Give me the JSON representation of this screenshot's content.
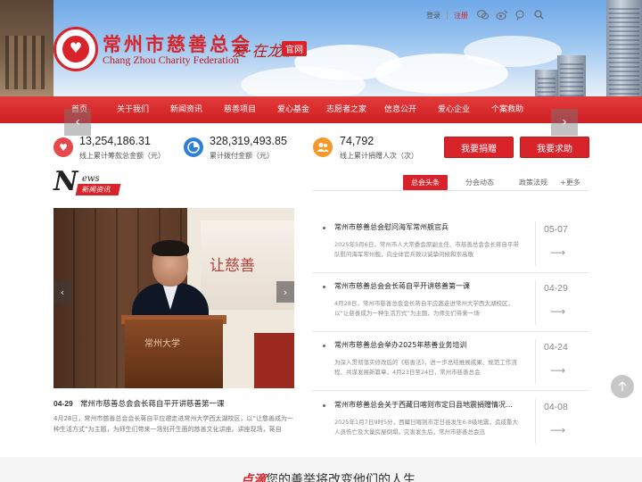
{
  "header": {
    "logo_title": "常州市慈善总会",
    "logo_subtitle": "Chang Zhou Charity Federation",
    "slogan": "爱·在龙",
    "slogan_mini": "城",
    "official_badge": "官网",
    "login": "登录",
    "register": "注册"
  },
  "nav": {
    "items": [
      "首页",
      "关于我们",
      "新闻资讯",
      "慈善项目",
      "爱心基金",
      "志愿者之家",
      "信息公开",
      "爱心企业",
      "个案救助"
    ]
  },
  "stats": [
    {
      "value": "13,254,186.31",
      "label": "线上累计筹款总金额（元）",
      "icon": "heart-icon",
      "color": "#e8474c"
    },
    {
      "value": "328,319,493.85",
      "label": "累计拨付金额（元）",
      "icon": "pie-chart-icon",
      "color": "#2f7fd6"
    },
    {
      "value": "74,792",
      "label": "线上累计捐赠人次（次）",
      "icon": "people-icon",
      "color": "#f39a2b"
    }
  ],
  "actions": {
    "donate": "我要捐赠",
    "help": "我要求助"
  },
  "news": {
    "heading_letter": "N",
    "heading_word": "ews",
    "heading_cn": "新闻资讯",
    "tabs": [
      "总会头条",
      "分会动态",
      "政策法规"
    ],
    "more": "+更多",
    "featured": {
      "date": "04-29",
      "title": "常州市慈善总会会长蒋自平开讲慈善第一课",
      "desc": "4月28日，常州市慈善总会会长蒋自平应邀走进常州大学西太湖校区，以“让慈善成为一种生活方式”为主题，为师生们带来一场别开生面的慈善文化讲座。讲座现场，蒋自",
      "banner_text": "让慈善",
      "podium_text": "常州大学"
    },
    "list": [
      {
        "title": "常州市慈善总会慰问海军常州舰官兵",
        "desc": "2025年5月6日，常州市人大常委会原副主任、市慈善总会会长蒋自平带队慰问海军常州舰，向全体官兵致以诚挚问候和崇高敬",
        "date": "05-07"
      },
      {
        "title": "常州市慈善总会会长蒋自平开讲慈善第一课",
        "desc": "4月28日，常州市慈善总会会长蒋自平应邀走进常州大学西太湖校区，以“让慈善成为一种生活方式”为主题，为师生们带来一场",
        "date": "04-29"
      },
      {
        "title": "常州市慈善总会举办2025年慈善业务培训",
        "desc": "为深入贯彻落实修改后的《慈善法》，进一步总结推展成果、规范工作流程、共谋发展新篇章，4月23日至24日，常州市慈善总会",
        "date": "04-24"
      },
      {
        "title": "常州市慈善总会关于西藏日喀则市定日县地震捐赠情况…",
        "desc": "2025年1月7日9时5分，西藏日喀则市定日县发生6.8级地震，造成重大人员伤亡及大量房屋倒塌。灾害发生后，常州市慈善总会迅",
        "date": "04-08"
      }
    ]
  },
  "bottom": {
    "accent": "点滴",
    "text": "您的善举将改变他们的人生"
  }
}
